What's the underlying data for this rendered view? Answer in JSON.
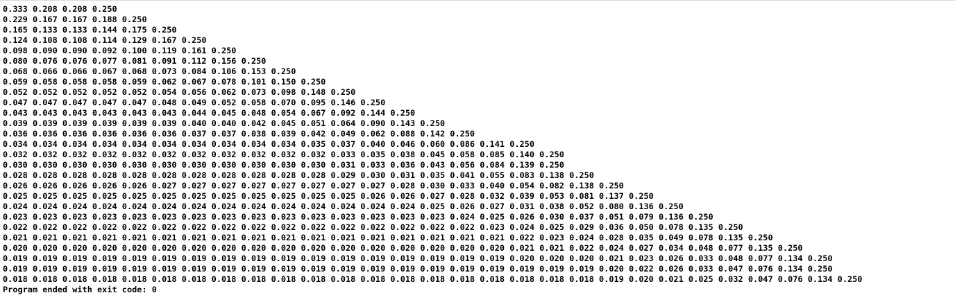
{
  "console": {
    "lines": [
      "0.333 0.208 0.208 0.250",
      "0.229 0.167 0.167 0.188 0.250",
      "0.165 0.133 0.133 0.144 0.175 0.250",
      "0.124 0.108 0.108 0.114 0.129 0.167 0.250",
      "0.098 0.090 0.090 0.092 0.100 0.119 0.161 0.250",
      "0.080 0.076 0.076 0.077 0.081 0.091 0.112 0.156 0.250",
      "0.068 0.066 0.066 0.067 0.068 0.073 0.084 0.106 0.153 0.250",
      "0.059 0.058 0.058 0.058 0.059 0.062 0.067 0.078 0.101 0.150 0.250",
      "0.052 0.052 0.052 0.052 0.052 0.054 0.056 0.062 0.073 0.098 0.148 0.250",
      "0.047 0.047 0.047 0.047 0.047 0.048 0.049 0.052 0.058 0.070 0.095 0.146 0.250",
      "0.043 0.043 0.043 0.043 0.043 0.043 0.044 0.045 0.048 0.054 0.067 0.092 0.144 0.250",
      "0.039 0.039 0.039 0.039 0.039 0.039 0.040 0.040 0.042 0.045 0.051 0.064 0.090 0.143 0.250",
      "0.036 0.036 0.036 0.036 0.036 0.036 0.037 0.037 0.038 0.039 0.042 0.049 0.062 0.088 0.142 0.250",
      "0.034 0.034 0.034 0.034 0.034 0.034 0.034 0.034 0.034 0.034 0.035 0.037 0.040 0.046 0.060 0.086 0.141 0.250",
      "0.032 0.032 0.032 0.032 0.032 0.032 0.032 0.032 0.032 0.032 0.032 0.033 0.035 0.038 0.045 0.058 0.085 0.140 0.250",
      "0.030 0.030 0.030 0.030 0.030 0.030 0.030 0.030 0.030 0.030 0.030 0.031 0.033 0.036 0.043 0.056 0.084 0.139 0.250",
      "0.028 0.028 0.028 0.028 0.028 0.028 0.028 0.028 0.028 0.028 0.028 0.029 0.030 0.031 0.035 0.041 0.055 0.083 0.138 0.250",
      "0.026 0.026 0.026 0.026 0.026 0.027 0.027 0.027 0.027 0.027 0.027 0.027 0.027 0.028 0.030 0.033 0.040 0.054 0.082 0.138 0.250",
      "0.025 0.025 0.025 0.025 0.025 0.025 0.025 0.025 0.025 0.025 0.025 0.025 0.026 0.026 0.027 0.028 0.032 0.039 0.053 0.081 0.137 0.250",
      "0.024 0.024 0.024 0.024 0.024 0.024 0.024 0.024 0.024 0.024 0.024 0.024 0.024 0.024 0.025 0.026 0.027 0.031 0.038 0.052 0.080 0.136 0.250",
      "0.023 0.023 0.023 0.023 0.023 0.023 0.023 0.023 0.023 0.023 0.023 0.023 0.023 0.023 0.023 0.024 0.025 0.026 0.030 0.037 0.051 0.079 0.136 0.250",
      "0.022 0.022 0.022 0.022 0.022 0.022 0.022 0.022 0.022 0.022 0.022 0.022 0.022 0.022 0.022 0.022 0.023 0.024 0.025 0.029 0.036 0.050 0.078 0.135 0.250",
      "0.021 0.021 0.021 0.021 0.021 0.021 0.021 0.021 0.021 0.021 0.021 0.021 0.021 0.021 0.021 0.021 0.021 0.022 0.023 0.024 0.028 0.035 0.049 0.078 0.135 0.250",
      "0.020 0.020 0.020 0.020 0.020 0.020 0.020 0.020 0.020 0.020 0.020 0.020 0.020 0.020 0.020 0.020 0.020 0.021 0.021 0.022 0.024 0.027 0.034 0.048 0.077 0.135 0.250",
      "0.019 0.019 0.019 0.019 0.019 0.019 0.019 0.019 0.019 0.019 0.019 0.019 0.019 0.019 0.019 0.019 0.019 0.020 0.020 0.020 0.021 0.023 0.026 0.033 0.048 0.077 0.134 0.250",
      "0.019 0.019 0.019 0.019 0.019 0.019 0.019 0.019 0.019 0.019 0.019 0.019 0.019 0.019 0.019 0.019 0.019 0.019 0.019 0.019 0.020 0.022 0.026 0.033 0.047 0.076 0.134 0.250",
      "0.018 0.018 0.018 0.018 0.018 0.018 0.018 0.018 0.018 0.018 0.018 0.018 0.018 0.018 0.018 0.018 0.018 0.018 0.018 0.018 0.019 0.020 0.021 0.025 0.032 0.047 0.076 0.134 0.250"
    ],
    "exit_message": "Program ended with exit code: 0"
  },
  "colors": {
    "background": "#ffffff",
    "text": "#000000",
    "top_border": "#d8d8d8"
  }
}
